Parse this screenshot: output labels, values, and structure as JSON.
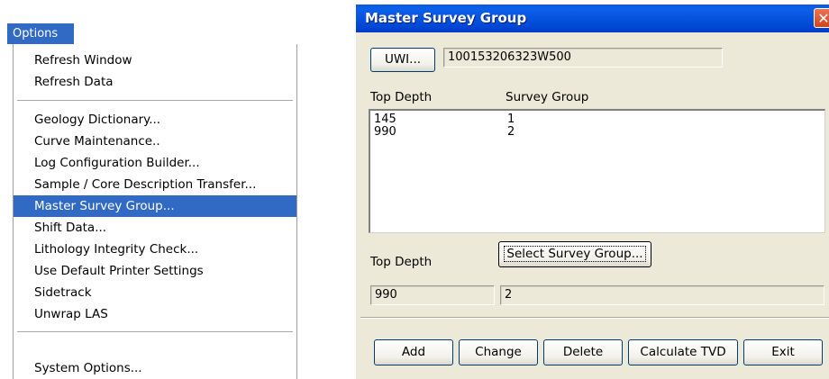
{
  "menu": {
    "header": "Options",
    "groups": [
      [
        "Refresh Window",
        "Refresh Data"
      ],
      [
        "Geology Dictionary...",
        "Curve Maintenance..",
        "Log Configuration Builder...",
        "Sample / Core Description Transfer...",
        "Master Survey Group...",
        "Shift Data...",
        "Lithology Integrity Check...",
        "Use Default Printer Settings",
        "Sidetrack",
        "Unwrap LAS"
      ],
      [
        "System Options..."
      ]
    ],
    "highlighted": "Master Survey Group..."
  },
  "dialog": {
    "title": "Master Survey Group",
    "uwi_button": "UWI...",
    "uwi_value": "100153206323W500",
    "list_headers": {
      "top_depth": "Top Depth",
      "survey_group": "Survey Group"
    },
    "rows": [
      {
        "top_depth": "145",
        "survey_group": "1"
      },
      {
        "top_depth": "990",
        "survey_group": "2"
      }
    ],
    "top_depth_label": "Top Depth",
    "select_button": "Select Survey Group...",
    "top_depth_value": "990",
    "survey_group_value": "2",
    "buttons": {
      "add": "Add",
      "change": "Change",
      "delete": "Delete",
      "calculate": "Calculate TVD",
      "exit": "Exit"
    }
  }
}
